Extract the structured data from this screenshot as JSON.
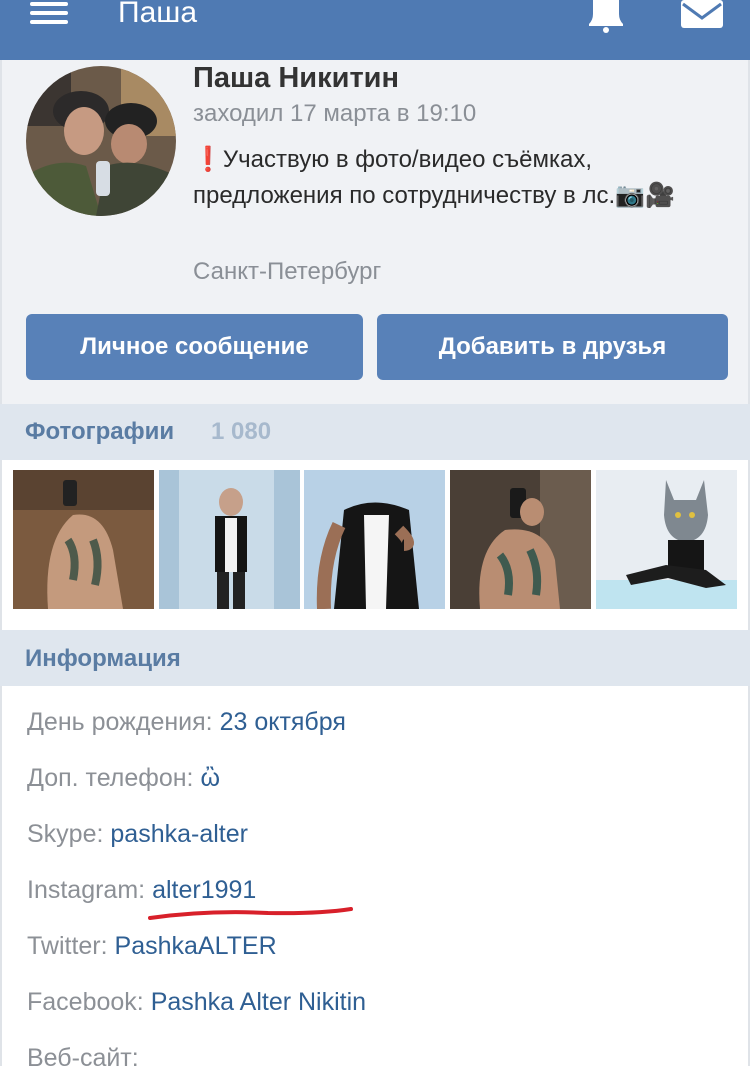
{
  "header": {
    "title": "Паша",
    "menu_icon": "hamburger-menu-icon",
    "bell_icon": "bell-icon",
    "mail_icon": "mail-envelope-icon"
  },
  "profile": {
    "name": "Паша Никитин",
    "last_seen": "заходил 17 марта в 19:10",
    "status_mark": "❗",
    "status_text": "Участвую в фото/видео съёмках, предложения по сотрудничеству в лс.📷🎥",
    "city": "Санкт-Петербург",
    "message_button": "Личное сообщение",
    "add_friend_button": "Добавить в друзья"
  },
  "photos": {
    "title": "Фотографии",
    "count": "1 080"
  },
  "info": {
    "title": "Информация",
    "rows": [
      {
        "label": "День рождения:",
        "value": "23 октября"
      },
      {
        "label": "Доп. телефон:",
        "value": "ὢ"
      },
      {
        "label": "Skype:",
        "value": "pashka-alter"
      },
      {
        "label": "Instagram:",
        "value": "alter1991"
      },
      {
        "label": "Twitter:",
        "value": "PashkaALTER"
      },
      {
        "label": "Facebook:",
        "value": "Pashka Alter Nikitin"
      },
      {
        "label": "Веб-сайт:",
        "value": ""
      }
    ]
  },
  "colors": {
    "header_bg": "#4f7ab3",
    "button_bg": "#5881b8",
    "section_bg": "#dfe6ee",
    "link": "#2f5f93",
    "underline_mark": "#d8202a"
  }
}
